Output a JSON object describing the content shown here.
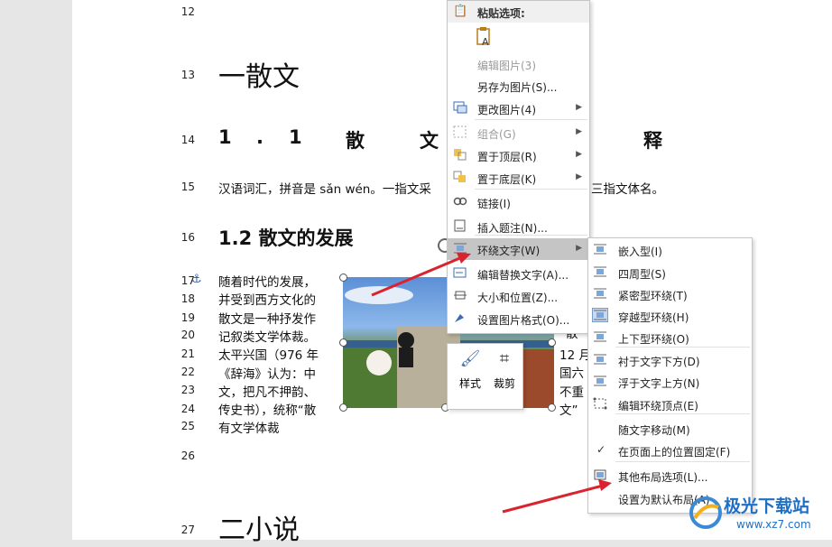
{
  "document": {
    "line_numbers": [
      "12",
      "13",
      "14",
      "15",
      "16",
      "17",
      "18",
      "19",
      "20",
      "21",
      "22",
      "23",
      "24",
      "25",
      "26",
      "27"
    ],
    "heading_sanwen": "一散文",
    "heading_11_chars": [
      "1",
      ".",
      "1",
      "散",
      "文",
      "释"
    ],
    "para_15": "汉语词汇，拼音是 sǎn wén。一指文采",
    "para_15_tail": "三指文体名。",
    "heading_12": "1.2 散文的发展",
    "para_lines_left": [
      "随着时代的发展，",
      "并受到西方文化的",
      "散文是一种抒发作",
      "记叙类文学体裁。",
      "太平兴国（976 年",
      "《辞海》认为：中",
      "文，把凡不押韵、",
      "传史书），统称“散",
      "有文学体裁"
    ],
    "para_lines_right": [
      "“散",
      "12 月",
      "国六",
      "不重",
      "文”"
    ],
    "heading_xiaoshuo": "二小说"
  },
  "context_menu": {
    "paste_header": "粘贴选项:",
    "items": [
      {
        "label": "编辑图片(3)",
        "disabled": true,
        "submenu": false,
        "icon": "none"
      },
      {
        "label": "另存为图片(S)...",
        "disabled": false,
        "submenu": false,
        "icon": "none"
      },
      {
        "label": "更改图片(4)",
        "disabled": false,
        "submenu": true,
        "icon": "change-picture-icon"
      },
      {
        "label": "组合(G)",
        "disabled": true,
        "submenu": true,
        "icon": "group-icon"
      },
      {
        "label": "置于顶层(R)",
        "disabled": false,
        "submenu": true,
        "icon": "bring-to-front-icon"
      },
      {
        "label": "置于底层(K)",
        "disabled": false,
        "submenu": true,
        "icon": "send-to-back-icon"
      },
      {
        "label": "链接(I)",
        "disabled": false,
        "submenu": false,
        "icon": "link-icon"
      },
      {
        "label": "插入题注(N)...",
        "disabled": false,
        "submenu": false,
        "icon": "caption-icon"
      },
      {
        "label": "环绕文字(W)",
        "disabled": false,
        "submenu": true,
        "icon": "wrap-text-icon",
        "highlighted": true
      },
      {
        "label": "编辑替换文字(A)...",
        "disabled": false,
        "submenu": false,
        "icon": "alt-text-icon"
      },
      {
        "label": "大小和位置(Z)...",
        "disabled": false,
        "submenu": false,
        "icon": "size-position-icon"
      },
      {
        "label": "设置图片格式(O)...",
        "disabled": false,
        "submenu": false,
        "icon": "format-picture-icon"
      }
    ]
  },
  "wrap_submenu": {
    "items": [
      {
        "label": "嵌入型(I)",
        "icon": "inline-wrap-icon"
      },
      {
        "label": "四周型(S)",
        "icon": "square-wrap-icon"
      },
      {
        "label": "紧密型环绕(T)",
        "icon": "tight-wrap-icon"
      },
      {
        "label": "穿越型环绕(H)",
        "icon": "through-wrap-icon",
        "active": true
      },
      {
        "label": "上下型环绕(O)",
        "icon": "top-bottom-wrap-icon"
      },
      {
        "label": "衬于文字下方(D)",
        "icon": "behind-text-icon"
      },
      {
        "label": "浮于文字上方(N)",
        "icon": "in-front-text-icon"
      },
      {
        "label": "编辑环绕顶点(E)",
        "icon": "edit-wrap-points-icon"
      },
      {
        "label": "随文字移动(M)",
        "icon": "none"
      },
      {
        "label": "在页面上的位置固定(F)",
        "icon": "checkmark-icon",
        "checked": true
      },
      {
        "label": "其他布局选项(L)...",
        "icon": "more-layout-icon"
      },
      {
        "label": "设置为默认布局(A)",
        "icon": "none"
      }
    ]
  },
  "mini_toolbar": {
    "style_label": "样式",
    "crop_label": "裁剪"
  },
  "watermark": {
    "brand": "极光下载站",
    "url": "www.xz7.com"
  },
  "colors": {
    "menu_highlight": "#c5c5c5",
    "arrow_red": "#d9232e",
    "page_bg": "#ffffff",
    "canvas_bg": "#e6e6e6"
  }
}
